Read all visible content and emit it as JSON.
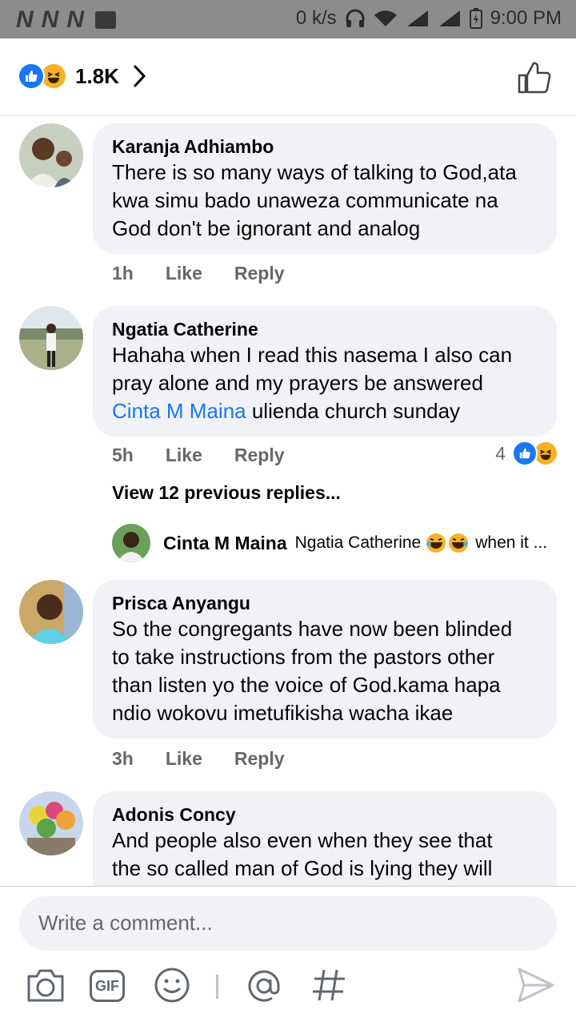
{
  "status_bar": {
    "left_icons": [
      "N",
      "N",
      "N"
    ],
    "speed": "0 k/s",
    "time": "9:00 PM"
  },
  "header": {
    "reaction_count": "1.8K",
    "reactions": [
      "like-icon",
      "haha-icon"
    ]
  },
  "comments": [
    {
      "name": "Karanja Adhiambo",
      "lines": [
        "There is so many ways of talking to God,ata",
        "kwa simu bado unaweza communicate na",
        "God don't be ignorant and analog"
      ],
      "time": "1h",
      "like": "Like",
      "reply": "Reply"
    },
    {
      "name": "Ngatia Catherine",
      "lines": [
        "Hahaha when I read this nasema I also can",
        "pray alone and my prayers be answered"
      ],
      "mention": "Cinta M Maina",
      "mention_tail": " ulienda church sunday",
      "time": "5h",
      "like": "Like",
      "reply": "Reply",
      "reaction_count": "4"
    },
    {
      "name": "Prisca Anyangu",
      "lines": [
        "So the congregants have now been blinded",
        "to take instructions from the pastors other",
        "than listen yo the voice of God.kama hapa",
        "ndio wokovu imetufikisha wacha ikae"
      ],
      "time": "3h",
      "like": "Like",
      "reply": "Reply"
    },
    {
      "name": "Adonis Concy",
      "lines": [
        "And people also even when they see that",
        "the so called man of God is lying they will"
      ]
    }
  ],
  "replies": {
    "view_previous": "View 12 previous replies...",
    "latest_name": "Cinta M Maina",
    "latest_text_prefix": "Ngatia Catherine",
    "latest_text_suffix": "when it ..."
  },
  "composer": {
    "placeholder": "Write a comment...",
    "tools": [
      "camera-icon",
      "gif-icon",
      "emoji-icon",
      "mention-icon",
      "hashtag-icon",
      "send-icon"
    ],
    "gif_label": "GIF"
  }
}
